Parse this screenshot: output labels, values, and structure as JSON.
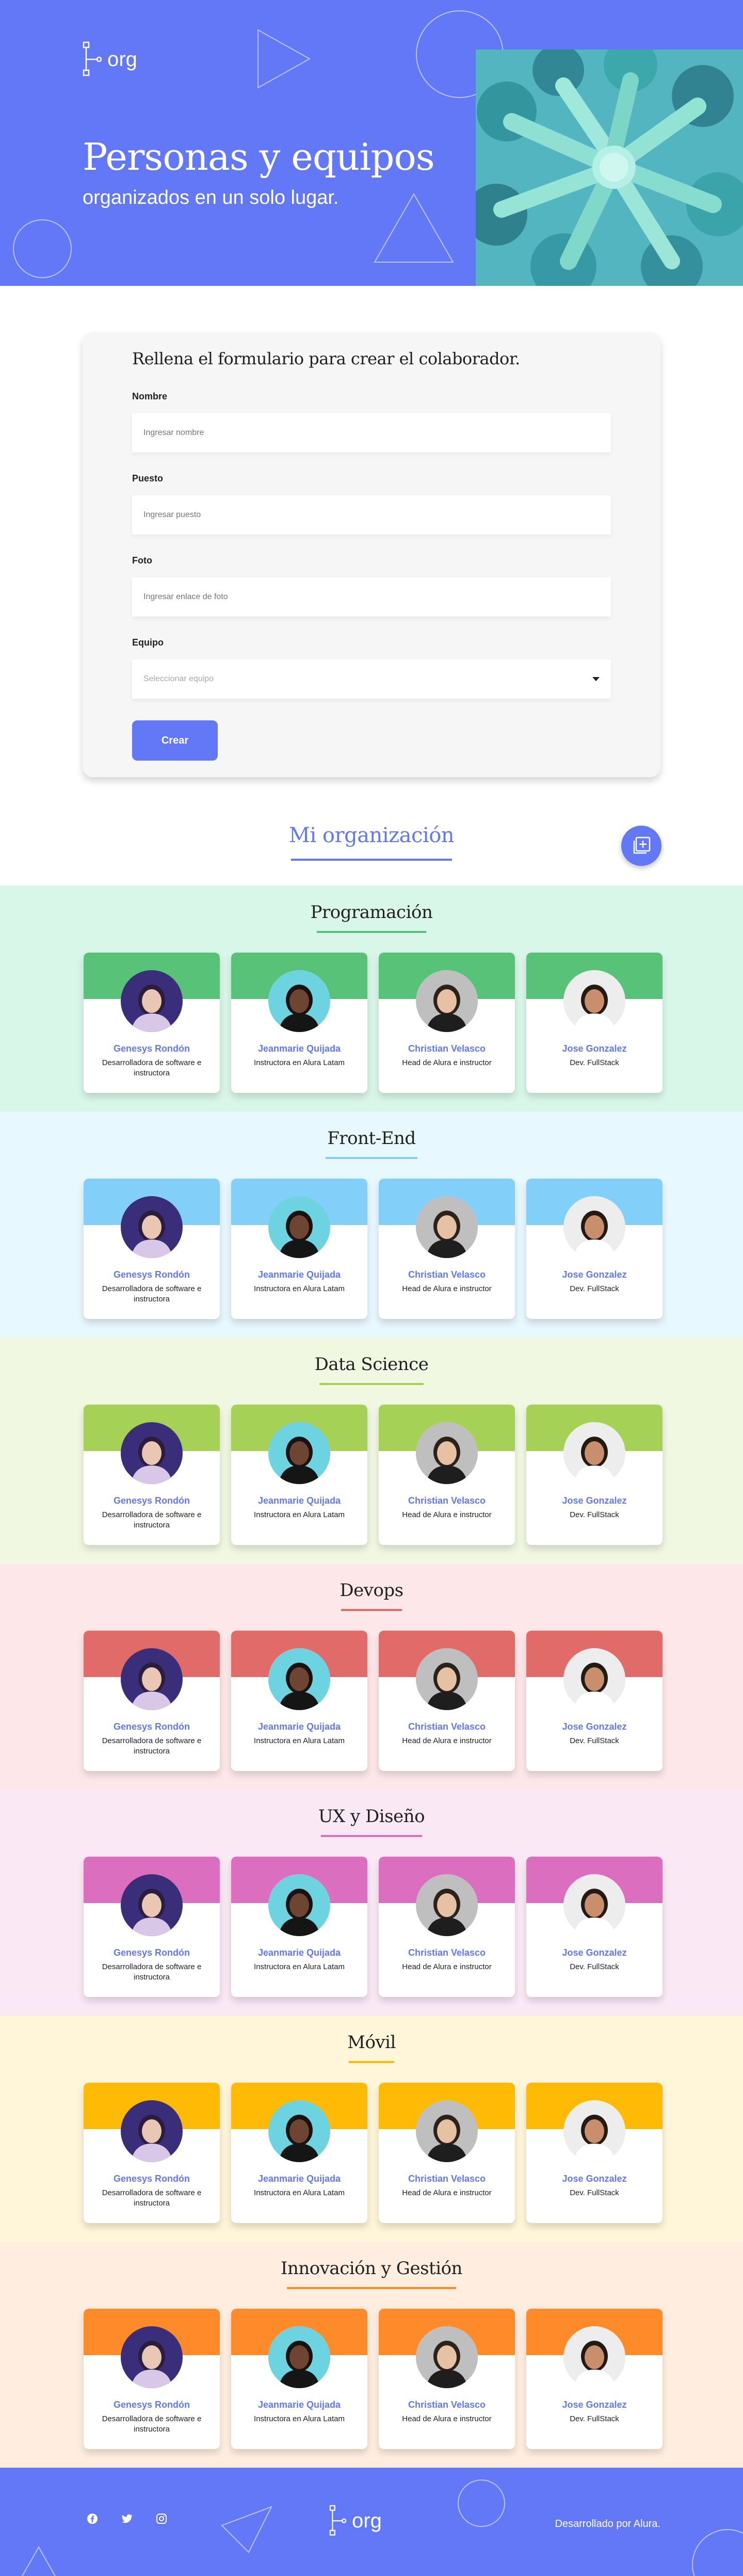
{
  "hero": {
    "logo_text": "org",
    "title": "Personas y equipos",
    "subtitle": "organizados en un solo lugar."
  },
  "form": {
    "heading": "Rellena el formulario para crear el colaborador.",
    "fields": {
      "nombre": {
        "label": "Nombre",
        "placeholder": "Ingresar nombre"
      },
      "puesto": {
        "label": "Puesto",
        "placeholder": "Ingresar puesto"
      },
      "foto": {
        "label": "Foto",
        "placeholder": "Ingresar enlace de foto"
      },
      "equipo": {
        "label": "Equipo",
        "placeholder": "Seleccionar equipo"
      }
    },
    "submit_label": "Crear"
  },
  "org": {
    "title": "Mi organización",
    "add_icon": "add-square-icon"
  },
  "members": [
    {
      "name": "Genesys Rondón",
      "role": "Desarrolladora de software e instructora"
    },
    {
      "name": "Jeanmarie Quijada",
      "role": "Instructora en Alura Latam"
    },
    {
      "name": "Christian Velasco",
      "role": "Head de Alura e instructor"
    },
    {
      "name": "Jose Gonzalez",
      "role": "Dev. FullStack"
    }
  ],
  "teams": [
    {
      "name": "Programación",
      "bg": "#D9F7E9",
      "accent": "#57C278"
    },
    {
      "name": "Front-End",
      "bg": "#E8F8FF",
      "accent": "#82CFFA"
    },
    {
      "name": "Data Science",
      "bg": "#F0F8E2",
      "accent": "#A6D157"
    },
    {
      "name": "Devops",
      "bg": "#FDE7E8",
      "accent": "#E06B69"
    },
    {
      "name": "UX y Diseño",
      "bg": "#FAE9F5",
      "accent": "#DB6EBF"
    },
    {
      "name": "Móvil",
      "bg": "#FFF5D9",
      "accent": "#FFBA05"
    },
    {
      "name": "Innovación y Gestión",
      "bg": "#FFEEDF",
      "accent": "#FF8A29"
    }
  ],
  "footer": {
    "logo_text": "org",
    "credits": "Desarrollado por Alura.",
    "socials": [
      "facebook-icon",
      "twitter-icon",
      "instagram-icon"
    ]
  },
  "colors": {
    "brand": "#6278F7",
    "hero_photo_tint": "#50C6A8"
  }
}
